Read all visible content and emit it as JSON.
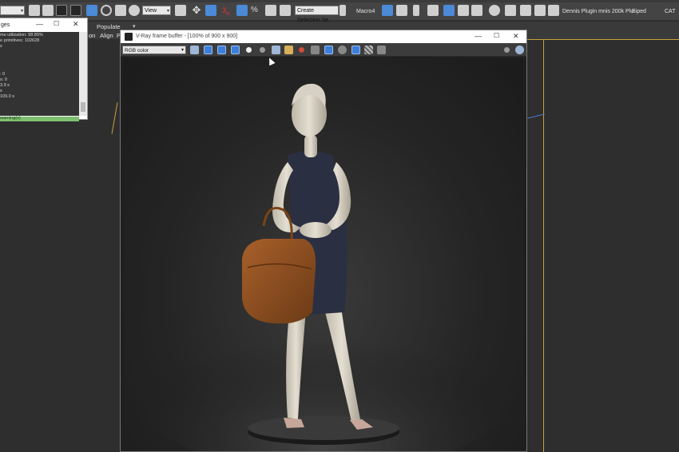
{
  "main_toolbar": {
    "view_dropdown": "View",
    "selection_set": "Create Selection Se",
    "macro_label": "Macro4",
    "plugin_label": "Dennis Plugin  mnis 200k Plu",
    "biped_label": "Biped",
    "cat_label": "CAT"
  },
  "ribbon": {
    "tab_populate": "Populate",
    "tab_chevron": "▾",
    "label_partial": "on",
    "label_align": "Align",
    "label_p": "P"
  },
  "messages_window": {
    "title": "ges",
    "lines": [
      "me utilization: 98.85%",
      "e primitives: 102628",
      "s",
      "",
      "",
      ": 0",
      "s: 0",
      "3.9 s",
      "s",
      "109.0 s",
      "warning(s)"
    ]
  },
  "vfb": {
    "title": "V-Ray frame buffer - [100% of 900 x 900]",
    "channel": "RGB color"
  },
  "colors": {
    "accent_blue": "#4b8ad6",
    "viewport_border": "#c8a23a",
    "highlight_green": "#7ec070"
  },
  "icons": {
    "window_minimize": "minimize-icon",
    "window_maximize": "maximize-icon",
    "window_close": "close-icon"
  }
}
